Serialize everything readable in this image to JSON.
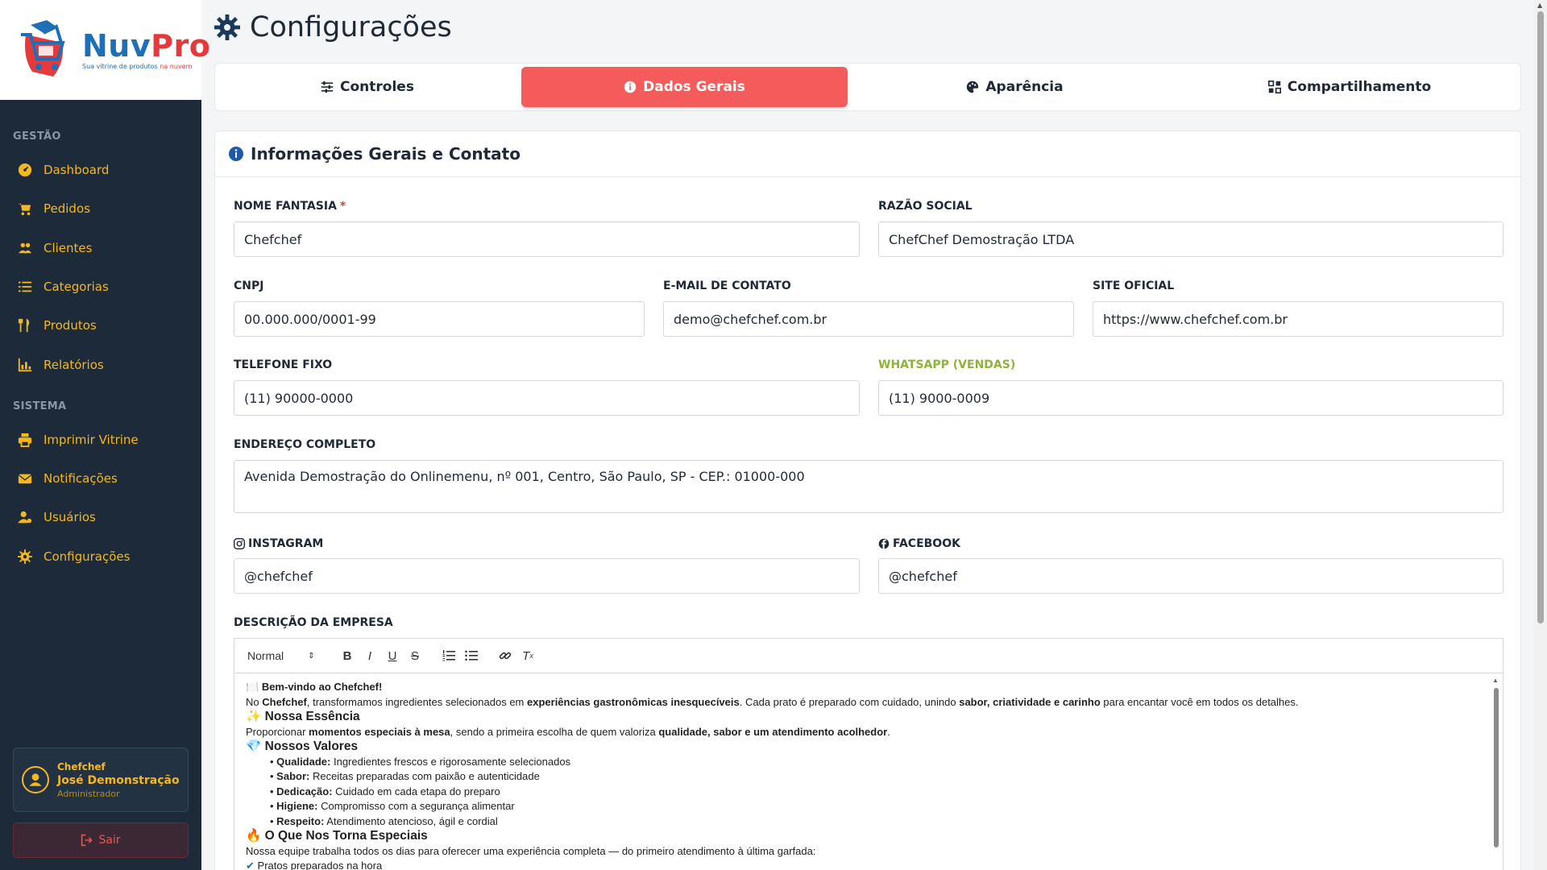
{
  "brand": {
    "name_part1": "Nuv",
    "name_part2": "Pro",
    "tagline_part1": "Sua vitrine de produtos ",
    "tagline_part2": "na nuvem"
  },
  "sidebar": {
    "section_gestao": "GESTÃO",
    "section_sistema": "SISTEMA",
    "items": [
      {
        "label": "Dashboard",
        "icon": "dashboard-icon"
      },
      {
        "label": "Pedidos",
        "icon": "cart-icon"
      },
      {
        "label": "Clientes",
        "icon": "users-icon"
      },
      {
        "label": "Categorias",
        "icon": "list-icon"
      },
      {
        "label": "Produtos",
        "icon": "utensils-icon"
      },
      {
        "label": "Relatórios",
        "icon": "chart-icon"
      },
      {
        "label": "Imprimir Vitrine",
        "icon": "printer-icon"
      },
      {
        "label": "Notificações",
        "icon": "envelope-icon"
      },
      {
        "label": "Usuários",
        "icon": "user-cog-icon"
      },
      {
        "label": "Configurações",
        "icon": "gear-icon"
      }
    ],
    "user": {
      "company": "Chefchef",
      "name": "José Demonstração",
      "role": "Administrador"
    },
    "logout_label": "Sair"
  },
  "page": {
    "title": "Configurações"
  },
  "tabs": [
    {
      "label": "Controles",
      "icon": "sliders-icon",
      "active": false
    },
    {
      "label": "Dados Gerais",
      "icon": "info-icon",
      "active": true
    },
    {
      "label": "Aparência",
      "icon": "palette-icon",
      "active": false
    },
    {
      "label": "Compartilhamento",
      "icon": "grid-icon",
      "active": false
    }
  ],
  "card": {
    "title": "Informações Gerais e Contato"
  },
  "form": {
    "nome_fantasia": {
      "label": "NOME FANTASIA",
      "required_mark": "*",
      "value": "Chefchef"
    },
    "razao_social": {
      "label": "RAZÃO SOCIAL",
      "value": "ChefChef Demostração LTDA"
    },
    "cnpj": {
      "label": "CNPJ",
      "value": "00.000.000/0001-99"
    },
    "email": {
      "label": "E-MAIL DE CONTATO",
      "value": "demo@chefchef.com.br"
    },
    "site": {
      "label": "SITE OFICIAL",
      "value": "https://www.chefchef.com.br"
    },
    "telefone": {
      "label": "TELEFONE FIXO",
      "value": "(11) 90000-0000"
    },
    "whatsapp": {
      "label": "WHATSAPP (VENDAS)",
      "value": "(11) 9000-0009"
    },
    "endereco": {
      "label": "ENDEREÇO COMPLETO",
      "value": "Avenida Demostração do Onlinemenu, nº 001, Centro, São Paulo, SP - CEP.: 01000-000"
    },
    "instagram": {
      "label": "INSTAGRAM",
      "value": "@chefchef"
    },
    "facebook": {
      "label": "FACEBOOK",
      "value": "@chefchef"
    },
    "descricao": {
      "label": "DESCRIÇÃO DA EMPRESA"
    }
  },
  "editor": {
    "format_select": "Normal",
    "welcome": "Bem-vindo ao Chefchef!",
    "intro_1": "No ",
    "intro_2": "Chefchef",
    "intro_3": ", transformamos ingredientes selecionados em ",
    "intro_4": "experiências gastronômicas inesquecíveis",
    "intro_5": ". Cada prato é preparado com cuidado, unindo ",
    "intro_6": "sabor, criatividade e carinho",
    "intro_7": " para encantar você em todos os detalhes.",
    "h_essencia": "Nossa Essência",
    "essencia_1": "Proporcionar ",
    "essencia_2": "momentos especiais à mesa",
    "essencia_3": ", sendo a primeira escolha de quem valoriza ",
    "essencia_4": "qualidade, sabor e um atendimento acolhedor",
    "essencia_5": ".",
    "h_valores": "Nossos Valores",
    "valores": [
      {
        "term": "Qualidade:",
        "text": " Ingredientes frescos e rigorosamente selecionados"
      },
      {
        "term": "Sabor:",
        "text": " Receitas preparadas com paixão e autenticidade"
      },
      {
        "term": "Dedicação:",
        "text": " Cuidado em cada etapa do preparo"
      },
      {
        "term": "Higiene:",
        "text": " Compromisso com a segurança alimentar"
      },
      {
        "term": "Respeito:",
        "text": " Atendimento atencioso, ágil e cordial"
      }
    ],
    "h_especiais": "O Que Nos Torna Especiais",
    "especiais_text": "Nossa equipe trabalha todos os dias para oferecer uma experiência completa — do primeiro atendimento à última garfada:",
    "especiais_item": "Pratos preparados na hora"
  },
  "colors": {
    "sidebar_bg": "#1d2a3a",
    "accent_yellow": "#f5b81c",
    "tab_active": "#f45b5b",
    "brand_blue": "#1e6fb8",
    "brand_red": "#e5393b",
    "whatsapp_label": "#8fb339"
  }
}
